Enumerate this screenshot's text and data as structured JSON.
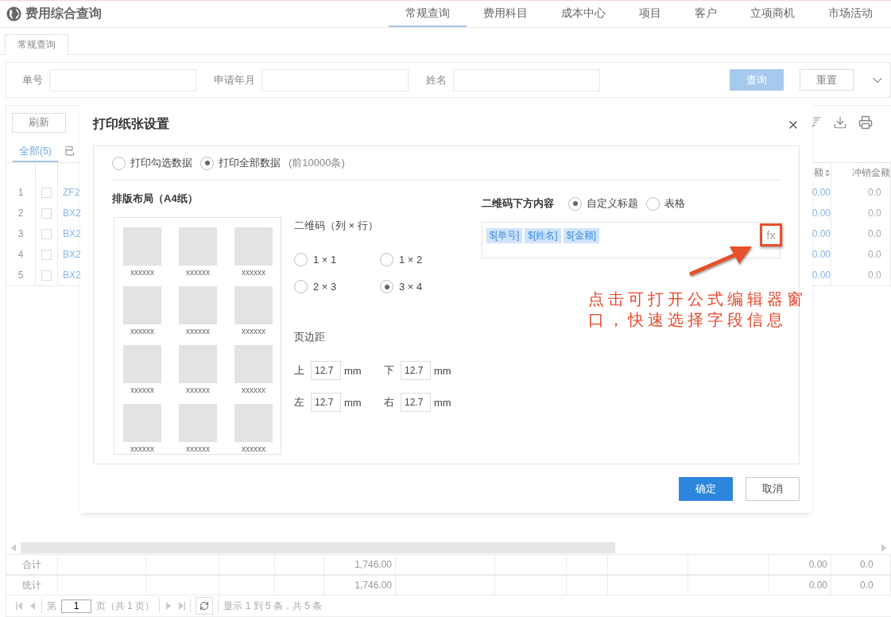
{
  "app": {
    "title": "费用综合查询"
  },
  "nav": [
    {
      "label": "常规查询",
      "selected": true
    },
    {
      "label": "费用科目",
      "selected": false
    },
    {
      "label": "成本中心",
      "selected": false
    },
    {
      "label": "项目",
      "selected": false
    },
    {
      "label": "客户",
      "selected": false
    },
    {
      "label": "立项商机",
      "selected": false
    },
    {
      "label": "市场活动",
      "selected": false
    }
  ],
  "page_tabs": [
    {
      "label": "常规查询",
      "selected": true
    }
  ],
  "search": {
    "fields": [
      {
        "label": "单号"
      },
      {
        "label": "申请年月"
      },
      {
        "label": "姓名"
      }
    ],
    "buttons": [
      {
        "label": "查询",
        "kind": "primary"
      },
      {
        "label": "重置",
        "kind": "default"
      }
    ]
  },
  "toolbar": {
    "refresh": "刷新"
  },
  "filter_tabs": [
    {
      "label": "全部",
      "count": "(5)",
      "selected": true
    },
    {
      "label": "已",
      "selected": false
    }
  ],
  "table": {
    "columns": [
      {
        "label": "额",
        "sortable": true
      },
      {
        "label": "冲销金额"
      }
    ],
    "rows": [
      {
        "index": "1",
        "checked": false,
        "code": "ZF2",
        "amount": "0.00",
        "writeoff": "0.0"
      },
      {
        "index": "2",
        "checked": false,
        "code": "BX2",
        "amount": "0.00",
        "writeoff": "0.0"
      },
      {
        "index": "3",
        "checked": false,
        "code": "BX2",
        "amount": "0.00",
        "writeoff": "0.0"
      },
      {
        "index": "4",
        "checked": false,
        "code": "BX2",
        "amount": "0.00",
        "writeoff": "0.0"
      },
      {
        "index": "5",
        "checked": false,
        "code": "BX2",
        "amount": "0.00",
        "writeoff": "0.0"
      }
    ]
  },
  "totals": [
    {
      "label": "合计",
      "total": "1,746.00",
      "amount": "0.00",
      "writeoff": "0.0"
    },
    {
      "label": "统计",
      "total": "1,746.00",
      "amount": "0.00",
      "writeoff": "0.0"
    }
  ],
  "pagination": {
    "prefix": "第",
    "page": "1",
    "suffix": "页（共 1 页）",
    "summary": "显示 1 到 5 条，共 5 条"
  },
  "dialog": {
    "title": "打印纸张设置",
    "scope_options": [
      {
        "label": "打印勾选数据",
        "selected": false
      },
      {
        "label": "打印全部数据",
        "selected": true
      }
    ],
    "scope_note": "(前10000条)",
    "layout_title": "排版布局（A4纸）",
    "preview_cells": [
      "xxxxxx",
      "xxxxxx",
      "xxxxxx",
      "xxxxxx",
      "xxxxxx",
      "xxxxxx",
      "xxxxxx",
      "xxxxxx",
      "xxxxxx",
      "xxxxxx",
      "xxxxxx",
      "xxxxxx"
    ],
    "grid_title": "二维码（列 × 行）",
    "grid_options": [
      {
        "label": "1 × 1",
        "selected": false
      },
      {
        "label": "1 × 2",
        "selected": false
      },
      {
        "label": "2 × 3",
        "selected": false
      },
      {
        "label": "3 × 4",
        "selected": true
      }
    ],
    "margin_title": "页边距",
    "margins": [
      {
        "label": "上",
        "value": "12.7",
        "unit": "mm"
      },
      {
        "label": "下",
        "value": "12.7",
        "unit": "mm"
      },
      {
        "label": "左",
        "value": "12.7",
        "unit": "mm"
      },
      {
        "label": "右",
        "value": "12.7",
        "unit": "mm"
      }
    ],
    "content_title": "二维码下方内容",
    "content_options": [
      {
        "label": "自定义标题",
        "selected": true
      },
      {
        "label": "表格",
        "selected": false
      }
    ],
    "content_tags": [
      "$[单号]",
      "$[姓名]",
      "$[金额]"
    ],
    "formula_button": "fx",
    "buttons": [
      {
        "label": "确定",
        "kind": "primary"
      },
      {
        "label": "取消",
        "kind": "default"
      }
    ]
  },
  "annotation": {
    "text": "点击可打开公式编辑器窗口，快速选择字段信息"
  }
}
